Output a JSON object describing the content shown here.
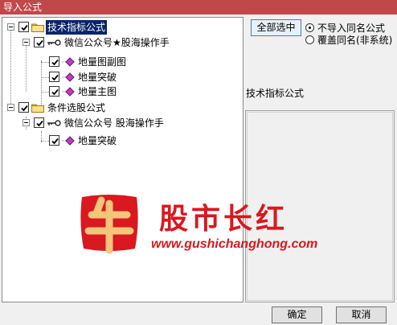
{
  "window": {
    "title": "导入公式"
  },
  "tree": {
    "groups": [
      {
        "label": "技术指标公式",
        "checked": true,
        "selected": true,
        "children": [
          {
            "label": "微信公众号★股海操作手",
            "checked": true,
            "items": [
              {
                "label": "地量图副图",
                "checked": true
              },
              {
                "label": "地量突破",
                "checked": true
              },
              {
                "label": "地量主图",
                "checked": true
              }
            ]
          }
        ]
      },
      {
        "label": "条件选股公式",
        "checked": true,
        "selected": false,
        "children": [
          {
            "label": "微信公众号 股海操作手",
            "checked": true,
            "items": [
              {
                "label": "地量突破",
                "checked": true
              }
            ]
          }
        ]
      }
    ]
  },
  "options": {
    "select_all_label": "全部选中",
    "radio_no_import": "不导入同名公式",
    "radio_overwrite": "覆盖同名(非系统)",
    "selected_radio": "no_import"
  },
  "detail": {
    "category_label": "技术指标公式"
  },
  "watermark": {
    "brand": "股市长红",
    "url": "www.gushichanghong.com",
    "seal_char": "牛"
  },
  "footer": {
    "ok_label": "确定",
    "cancel_label": "取消"
  },
  "colors": {
    "titlebar": "#c0474a",
    "selection": "#0a246a",
    "watermark_red": "#d9181f"
  }
}
